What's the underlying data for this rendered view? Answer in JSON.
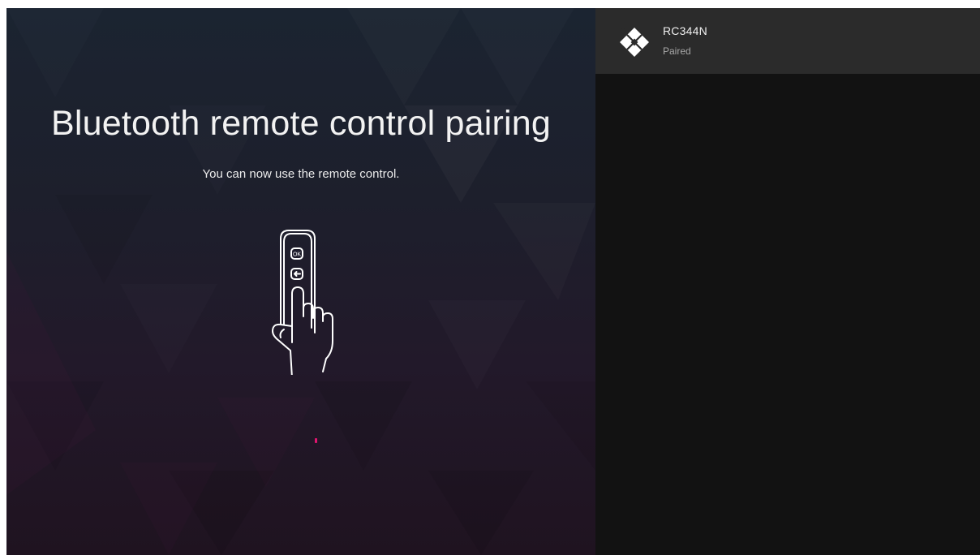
{
  "pairing": {
    "title": "Bluetooth remote control pairing",
    "message": "You can now use the remote control."
  },
  "illustration": {
    "ok_button_label": "OK",
    "back_button_icon": "back-arrow-icon"
  },
  "devices": [
    {
      "name": "RC344N",
      "status": "Paired",
      "icon": "gamepad-icon"
    }
  ],
  "colors": {
    "accent": "#e0156f",
    "panel_selected": "#2b2b2b",
    "panel_bg": "#121212"
  }
}
